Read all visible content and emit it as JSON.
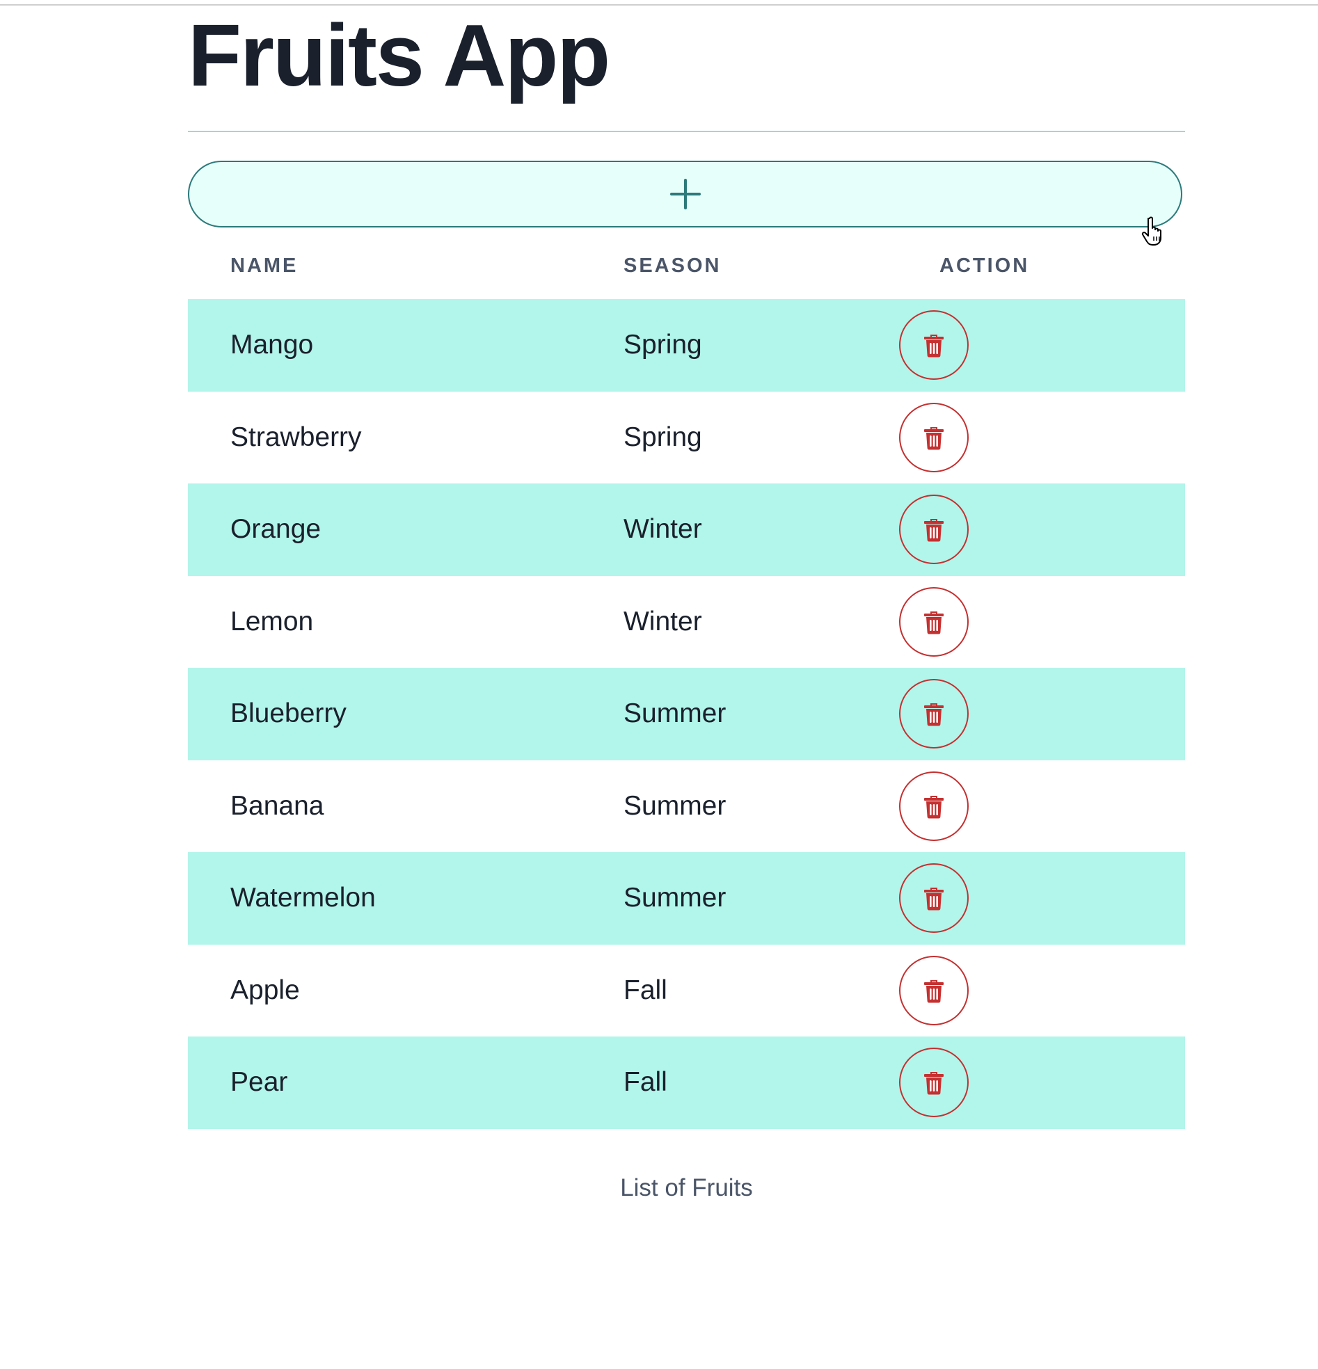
{
  "app": {
    "title": "Fruits App"
  },
  "toolbar": {
    "add_icon": "plus-icon"
  },
  "table": {
    "headers": {
      "name": "NAME",
      "season": "SEASON",
      "action": "ACTION"
    },
    "rows": [
      {
        "name": "Mango",
        "season": "Spring"
      },
      {
        "name": "Strawberry",
        "season": "Spring"
      },
      {
        "name": "Orange",
        "season": "Winter"
      },
      {
        "name": "Lemon",
        "season": "Winter"
      },
      {
        "name": "Blueberry",
        "season": "Summer"
      },
      {
        "name": "Banana",
        "season": "Summer"
      },
      {
        "name": "Watermelon",
        "season": "Summer"
      },
      {
        "name": "Apple",
        "season": "Fall"
      },
      {
        "name": "Pear",
        "season": "Fall"
      }
    ],
    "action_icon": "trash-icon",
    "caption": "List of Fruits"
  },
  "colors": {
    "accent": "#2c7a7b",
    "stripe": "#b2f5ea",
    "add_button_bg": "#e6fffa",
    "delete": "#c53030",
    "divider": "#81e6d9"
  }
}
